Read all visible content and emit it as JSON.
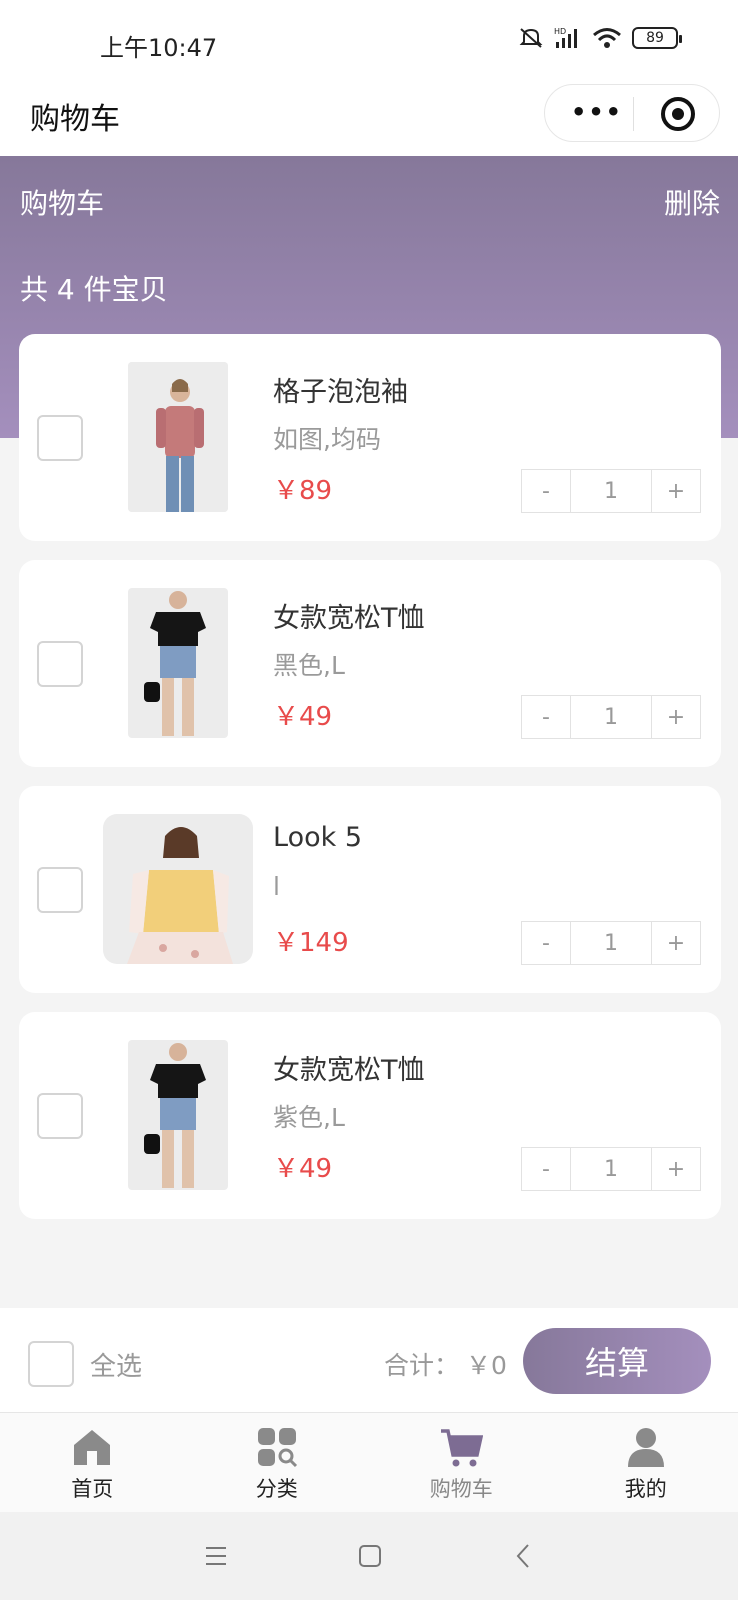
{
  "status_bar": {
    "time": "上午10:47",
    "battery": "89",
    "network_label": "HD"
  },
  "title_bar": {
    "title": "购物车",
    "more_icon": "more-dots-icon",
    "target_icon": "target-icon"
  },
  "header": {
    "title": "购物车",
    "delete_label": "删除",
    "count_text": "共 4 件宝贝",
    "gradient_colors": [
      "#86789a",
      "#a48fbd"
    ]
  },
  "cart_items": [
    {
      "name": "格子泡泡袖",
      "spec": "如图,均码",
      "price": "￥89",
      "quantity": "1",
      "image": "plaid-puff-sleeve-photo"
    },
    {
      "name": "女款宽松T恤",
      "spec": "黑色,L",
      "price": "￥49",
      "quantity": "1",
      "image": "black-tshirt-photo"
    },
    {
      "name": "Look 5",
      "spec": "l",
      "price": "￥149",
      "quantity": "1",
      "image": "yellow-vest-photo"
    },
    {
      "name": "女款宽松T恤",
      "spec": "紫色,L",
      "price": "￥49",
      "quantity": "1",
      "image": "black-tshirt-photo"
    }
  ],
  "stepper": {
    "minus": "-",
    "plus": "+"
  },
  "checkout": {
    "select_all_label": "全选",
    "total_label": "合计：",
    "total_value": "￥0",
    "pay_button": "结算",
    "price_color": "#e84b4b"
  },
  "tabbar": [
    {
      "label": "首页",
      "icon": "home-icon"
    },
    {
      "label": "分类",
      "icon": "category-icon"
    },
    {
      "label": "购物车",
      "icon": "cart-icon"
    },
    {
      "label": "我的",
      "icon": "user-icon"
    }
  ]
}
